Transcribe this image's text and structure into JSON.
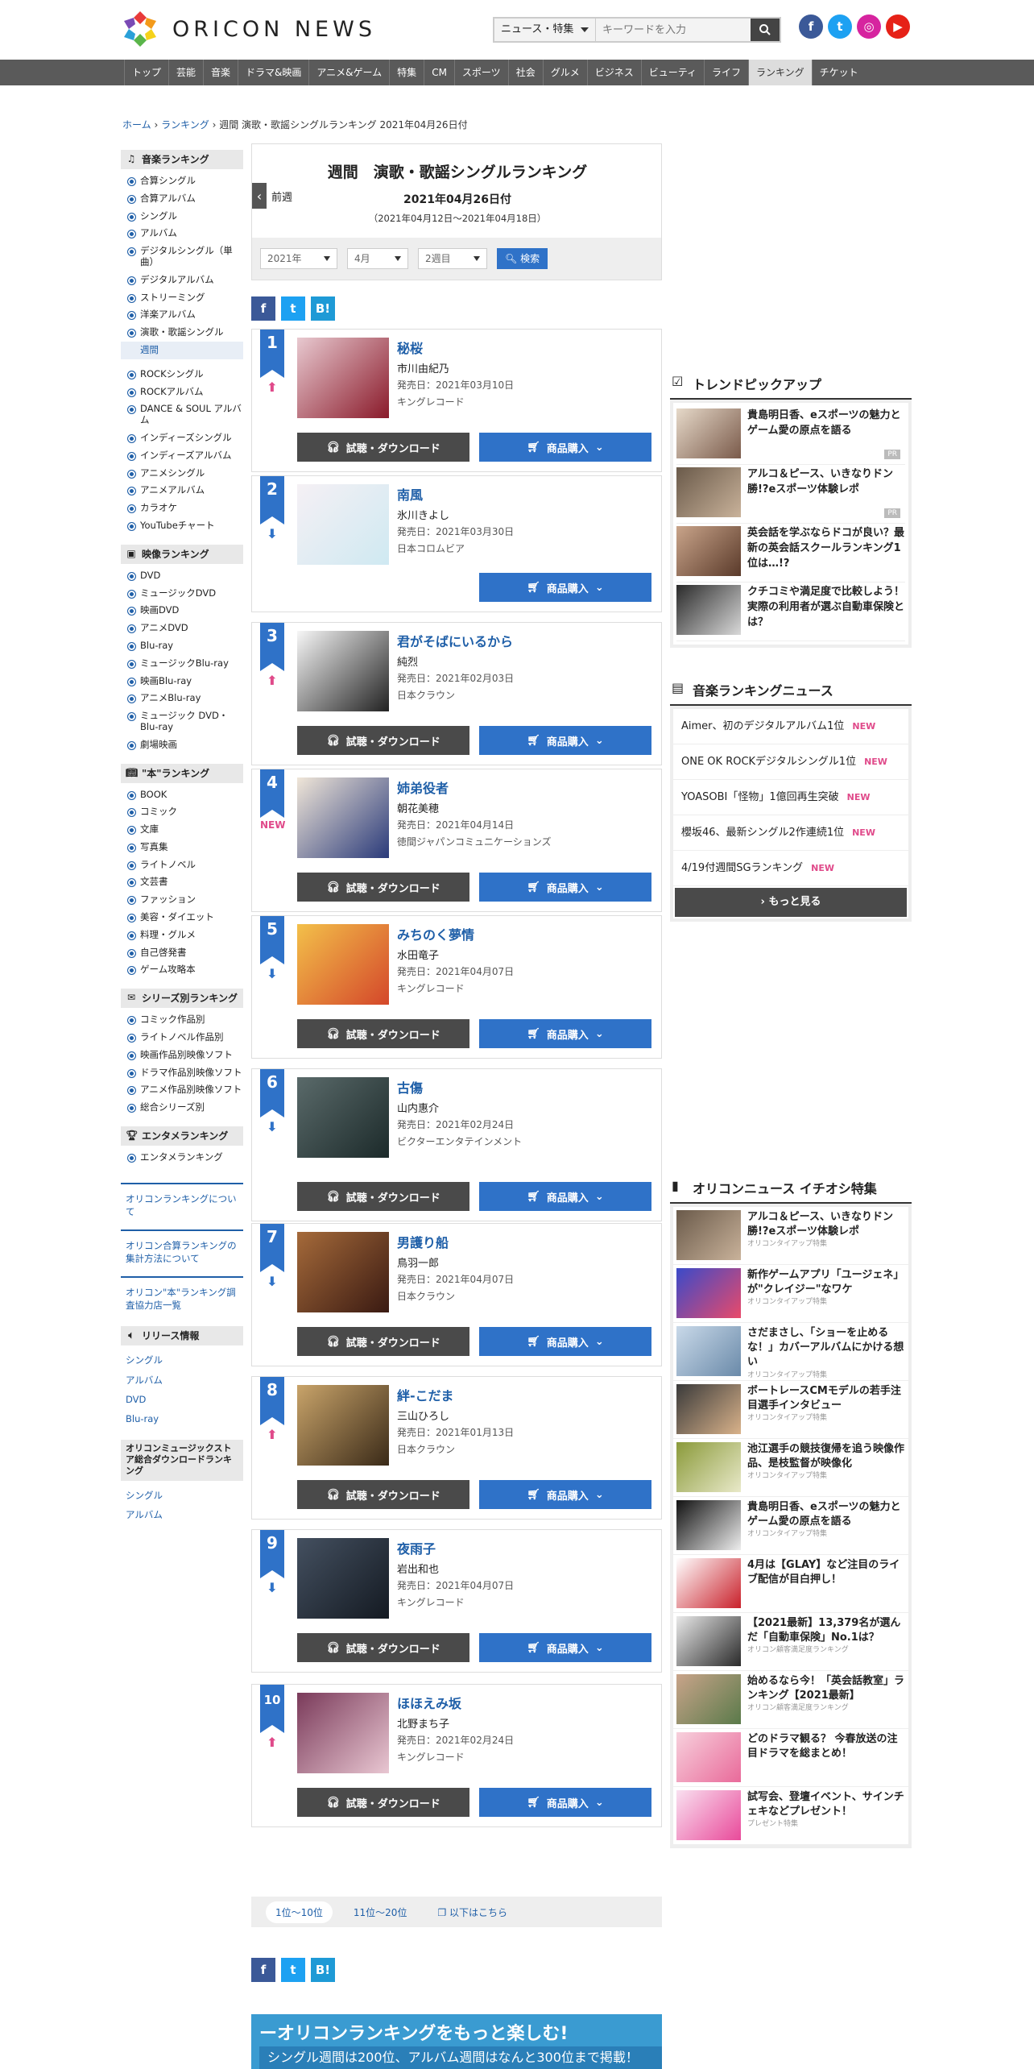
{
  "header": {
    "logo_text": "ORICON NEWS",
    "search_category": "ニュース・特集",
    "search_placeholder": "キーワードを入力"
  },
  "gnav": [
    "トップ",
    "芸能",
    "音楽",
    "ドラマ&映画",
    "アニメ&ゲーム",
    "特集",
    "CM",
    "スポーツ",
    "社会",
    "グルメ",
    "ビジネス",
    "ビューティ",
    "ライフ",
    "ランキング",
    "チケット"
  ],
  "breadcrumb": {
    "home": "ホーム",
    "ranking": "ランキング",
    "current": "週間 演歌・歌謡シングルランキング 2021年04月26日付"
  },
  "sidebar": {
    "music_head": "音楽ランキング",
    "music": [
      "合算シングル",
      "合算アルバム",
      "シングル",
      "アルバム",
      "デジタルシングル（単曲）",
      "デジタルアルバム",
      "ストリーミング",
      "洋楽アルバム",
      "演歌・歌謡シングル"
    ],
    "music_sub": "週間",
    "music2": [
      "ROCKシングル",
      "ROCKアルバム",
      "DANCE & SOUL アルバム",
      "インディーズシングル",
      "インディーズアルバム",
      "アニメシングル",
      "アニメアルバム",
      "カラオケ",
      "YouTubeチャート"
    ],
    "video_head": "映像ランキング",
    "video": [
      "DVD",
      "ミュージックDVD",
      "映画DVD",
      "アニメDVD",
      "Blu-ray",
      "ミュージックBlu-ray",
      "映画Blu-ray",
      "アニメBlu-ray",
      "ミュージック DVD・Blu-ray",
      "劇場映画"
    ],
    "book_head": "\"本\"ランキング",
    "book": [
      "BOOK",
      "コミック",
      "文庫",
      "写真集",
      "ライトノベル",
      "文芸書",
      "ファッション",
      "美容・ダイエット",
      "料理・グルメ",
      "自己啓発書",
      "ゲーム攻略本"
    ],
    "series_head": "シリーズ別ランキング",
    "series": [
      "コミック作品別",
      "ライトノベル作品別",
      "映画作品別映像ソフト",
      "ドラマ作品別映像ソフト",
      "アニメ作品別映像ソフト",
      "総合シリーズ別"
    ],
    "ent_head": "エンタメランキング",
    "ent": [
      "エンタメランキング"
    ],
    "links": [
      "オリコンランキングについて",
      "オリコン合算ランキングの集計方法について",
      "オリコン\"本\"ランキング調査協力店一覧"
    ],
    "release_head": "リリース情報",
    "release": [
      "シングル",
      "アルバム",
      "DVD",
      "Blu-ray"
    ],
    "store_head": "オリコンミュージックストア総合ダウンロードランキング",
    "store": [
      "シングル",
      "アルバム"
    ]
  },
  "main": {
    "title": "週間　演歌・歌謡シングルランキング",
    "prev": "前週",
    "date": "2021年04月26日付",
    "range": "（2021年04月12日～2021年04月18日）",
    "filter": {
      "year": "2021年",
      "month": "4月",
      "week": "2週目",
      "search": "検索"
    },
    "release_prefix": "発売日：",
    "dl_label": "試聴・ダウンロード",
    "buy_label": "商品購入",
    "items": [
      {
        "rank": "1",
        "trend": "up",
        "song": "秘桜",
        "artist": "市川由紀乃",
        "date": "2021年03月10日",
        "label": "キングレコード",
        "dl": true,
        "c": [
          "#8a1a2a",
          "#e8c9d0"
        ]
      },
      {
        "rank": "2",
        "trend": "down",
        "song": "南風",
        "artist": "氷川きよし",
        "date": "2021年03月30日",
        "label": "日本コロムビア",
        "dl": false,
        "c": [
          "#cfe9f2",
          "#f5f0f4"
        ]
      },
      {
        "rank": "3",
        "trend": "up",
        "song": "君がそばにいるから",
        "artist": "純烈",
        "date": "2021年02月03日",
        "label": "日本クラウン",
        "dl": true,
        "c": [
          "#222",
          "#f7f7f7"
        ]
      },
      {
        "rank": "4",
        "trend": "new",
        "song": "姉弟役者",
        "artist": "朝花美穂",
        "date": "2021年04月14日",
        "label": "徳間ジャパンコミュニケーションズ",
        "dl": true,
        "c": [
          "#2a3a7a",
          "#f0e6d8"
        ]
      },
      {
        "rank": "5",
        "trend": "down",
        "song": "みちのく夢情",
        "artist": "水田竜子",
        "date": "2021年04月07日",
        "label": "キングレコード",
        "dl": true,
        "c": [
          "#d4472a",
          "#f3c04a"
        ]
      },
      {
        "rank": "6",
        "trend": "down",
        "song": "古傷",
        "artist": "山内惠介",
        "date": "2021年02月24日",
        "label": "ビクターエンタテインメント",
        "dl": true,
        "c": [
          "#1c2a2a",
          "#5a6a6a"
        ]
      },
      {
        "rank": "7",
        "trend": "down",
        "song": "男護り船",
        "artist": "鳥羽一郎",
        "date": "2021年04月07日",
        "label": "日本クラウン",
        "dl": true,
        "c": [
          "#3a1a12",
          "#a56a3a"
        ]
      },
      {
        "rank": "8",
        "trend": "up",
        "song": "絆-こだま",
        "artist": "三山ひろし",
        "date": "2021年01月13日",
        "label": "日本クラウン",
        "dl": true,
        "c": [
          "#3a2a18",
          "#c9a46a"
        ]
      },
      {
        "rank": "9",
        "trend": "down",
        "song": "夜雨子",
        "artist": "岩出和也",
        "date": "2021年04月07日",
        "label": "キングレコード",
        "dl": true,
        "c": [
          "#141a22",
          "#445060"
        ]
      },
      {
        "rank": "10",
        "trend": "up",
        "song": "ほほえみ坂",
        "artist": "北野まち子",
        "date": "2021年02月24日",
        "label": "キングレコード",
        "dl": true,
        "c": [
          "#e9c7d2",
          "#7a3a5a"
        ]
      }
    ],
    "new_label": "NEW",
    "pager": [
      "1位～10位",
      "11位～20位",
      "以下はこちら"
    ],
    "banner_title": "ーオリコンランキングをもっと楽しむ!",
    "banner_sub": "シングル週間は200位、アルバム週間はなんと300位まで掲載！"
  },
  "right": {
    "trend_head": "トレンドピックアップ",
    "trend": [
      {
        "t": "貴島明日香、eスポーツの魅力とゲーム愛の原点を語る",
        "pr": "PR",
        "c": [
          "#e6d9c9",
          "#7a5a4a"
        ]
      },
      {
        "t": "アルコ＆ピース、いきなりドン勝!?eスポーツ体験レポ",
        "pr": "PR",
        "c": [
          "#6a5a4a",
          "#c9b29a"
        ]
      },
      {
        "t": "英会話を学ぶならドコが良い？最新の英会話スクールランキング1位は…!?",
        "pr": "",
        "c": [
          "#c9a48a",
          "#5a3a2a"
        ]
      },
      {
        "t": "クチコミや満足度で比較しよう！実際の利用者が選ぶ自動車保険とは？",
        "pr": "",
        "c": [
          "#2a2a2a",
          "#d9d9d9"
        ]
      }
    ],
    "news_head": "音楽ランキングニュース",
    "news": [
      "Aimer、初のデジタルアルバム1位",
      "ONE OK ROCKデジタルシングル1位",
      "YOASOBI「怪物」1億回再生突破",
      "櫻坂46、最新シングル2作連続1位",
      "4/19付週間SGランキング"
    ],
    "news_new": "NEW",
    "more": "もっと見る",
    "feature_head": "オリコンニュース イチオシ特集",
    "feature": [
      {
        "t": "アルコ＆ピース、いきなりドン勝!?eスポーツ体験レポ",
        "s": "オリコンタイアップ特集",
        "c": [
          "#6a5a4a",
          "#c9b29a"
        ]
      },
      {
        "t": "新作ゲームアプリ「ユージェネ」が\"クレイジー\"なワケ",
        "s": "オリコンタイアップ特集",
        "c": [
          "#3a4ac9",
          "#e94a6a"
        ]
      },
      {
        "t": "さだまさし、「ショーを止めるな！」カバーアルバムにかける想い",
        "s": "オリコンタイアップ特集",
        "c": [
          "#c9d9e9",
          "#6a8aa9"
        ]
      },
      {
        "t": "ボートレースCMモデルの若手注目選手インタビュー",
        "s": "オリコンタイアップ特集",
        "c": [
          "#3a3a3a",
          "#d9b28a"
        ]
      },
      {
        "t": "池江選手の競技復帰を追う映像作品、是枝監督が映像化",
        "s": "オリコンタイアップ特集",
        "c": [
          "#8a9a3a",
          "#e9e9c9"
        ]
      },
      {
        "t": "貴島明日香、eスポーツの魅力とゲーム愛の原点を語る",
        "s": "オリコンタイアップ特集",
        "c": [
          "#111",
          "#eee"
        ]
      },
      {
        "t": "4月は【GLAY】など注目のライブ配信が目白押し！",
        "s": "",
        "c": [
          "#fff",
          "#c9202a"
        ]
      },
      {
        "t": "【2021最新】13,379名が選んだ「自動車保険」No.1は？",
        "s": "オリコン顧客満足度ランキング",
        "c": [
          "#e9e9e9",
          "#2a2a2a"
        ]
      },
      {
        "t": "始めるなら今！「英会話教室」ランキング【2021最新】",
        "s": "オリコン顧客満足度ランキング",
        "c": [
          "#c9a48a",
          "#5a7a4a"
        ]
      },
      {
        "t": "どのドラマ観る？ 今春放送の注目ドラマを総まとめ！",
        "s": "",
        "c": [
          "#f7d0dc",
          "#e96a9a"
        ]
      },
      {
        "t": "試写会、登壇イベント、サインチェキなどプレゼント！",
        "s": "プレゼント特集",
        "c": [
          "#f9e0f0",
          "#e94a9a"
        ]
      }
    ]
  }
}
